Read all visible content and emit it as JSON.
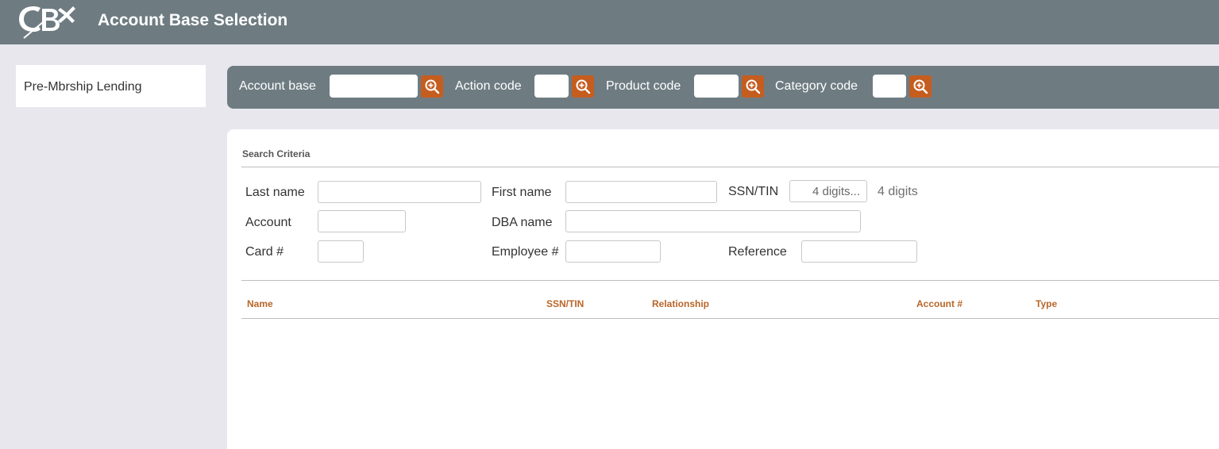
{
  "header": {
    "logo_text": "CB",
    "title": "Account Base Selection"
  },
  "sidebar": {
    "items": [
      {
        "label": "Pre-Mbrship Lending"
      }
    ]
  },
  "toolbar": {
    "account_base_label": "Account base",
    "account_base_value": "",
    "action_code_label": "Action code",
    "action_code_value": "",
    "product_code_label": "Product code",
    "product_code_value": "",
    "category_code_label": "Category code",
    "category_code_value": ""
  },
  "search": {
    "section_title": "Search Criteria",
    "last_name_label": "Last name",
    "first_name_label": "First name",
    "ssn_label": "SSN/TIN",
    "ssn_placeholder": "4 digits...",
    "ssn_hint": "4 digits",
    "account_label": "Account",
    "dba_label": "DBA name",
    "card_label": "Card #",
    "employee_label": "Employee #",
    "reference_label": "Reference"
  },
  "results": {
    "columns": [
      "Name",
      "SSN/TIN",
      "Relationship",
      "Account #",
      "Type"
    ]
  },
  "colors": {
    "header_bg": "#6e7c82",
    "accent": "#c55d1f",
    "column_header": "#b8662a",
    "page_bg": "#e8e7ee"
  },
  "icons": {
    "lookup": "zoom-in-icon",
    "logo": "cbx-logo-icon"
  }
}
